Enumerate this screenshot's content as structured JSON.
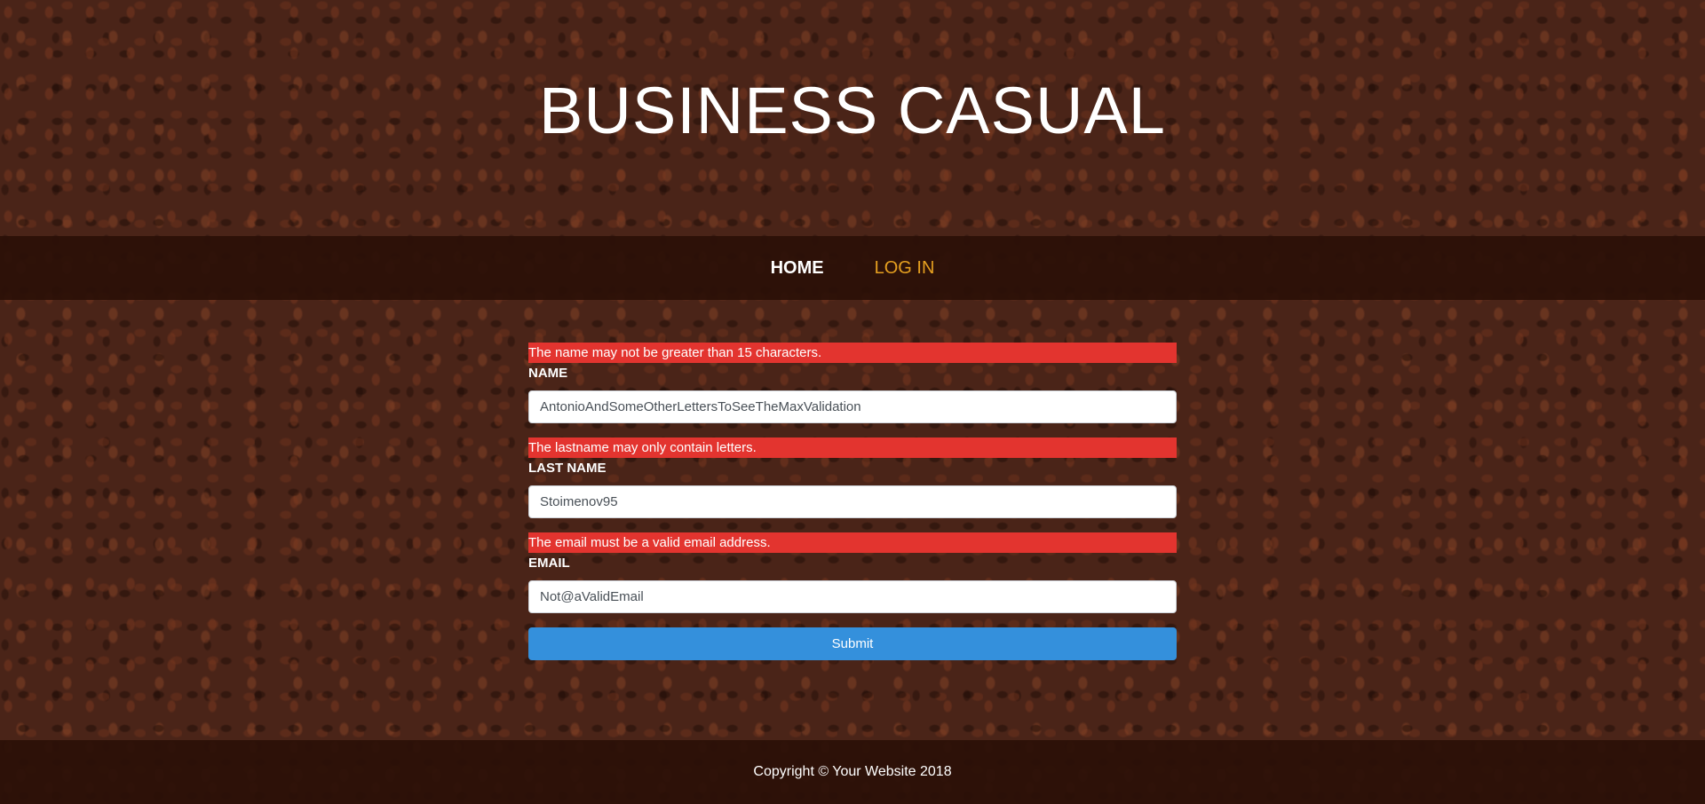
{
  "header": {
    "title": "BUSINESS CASUAL"
  },
  "nav": {
    "items": [
      {
        "label": "HOME"
      },
      {
        "label": "LOG IN"
      }
    ],
    "active_color": "#e6a020"
  },
  "form": {
    "fields": [
      {
        "error": "The name may not be greater than 15 characters.",
        "label": "NAME",
        "value": "AntonioAndSomeOtherLettersToSeeTheMaxValidation"
      },
      {
        "error": "The lastname may only contain letters.",
        "label": "LAST NAME",
        "value": "Stoimenov95"
      },
      {
        "error": "The email must be a valid email address.",
        "label": "EMAIL",
        "value": "Not@aValidEmail"
      }
    ],
    "submit_label": "Submit",
    "error_color": "#e3342f",
    "submit_color": "#3490dc"
  },
  "footer": {
    "copyright": "Copyright © Your Website 2018"
  }
}
